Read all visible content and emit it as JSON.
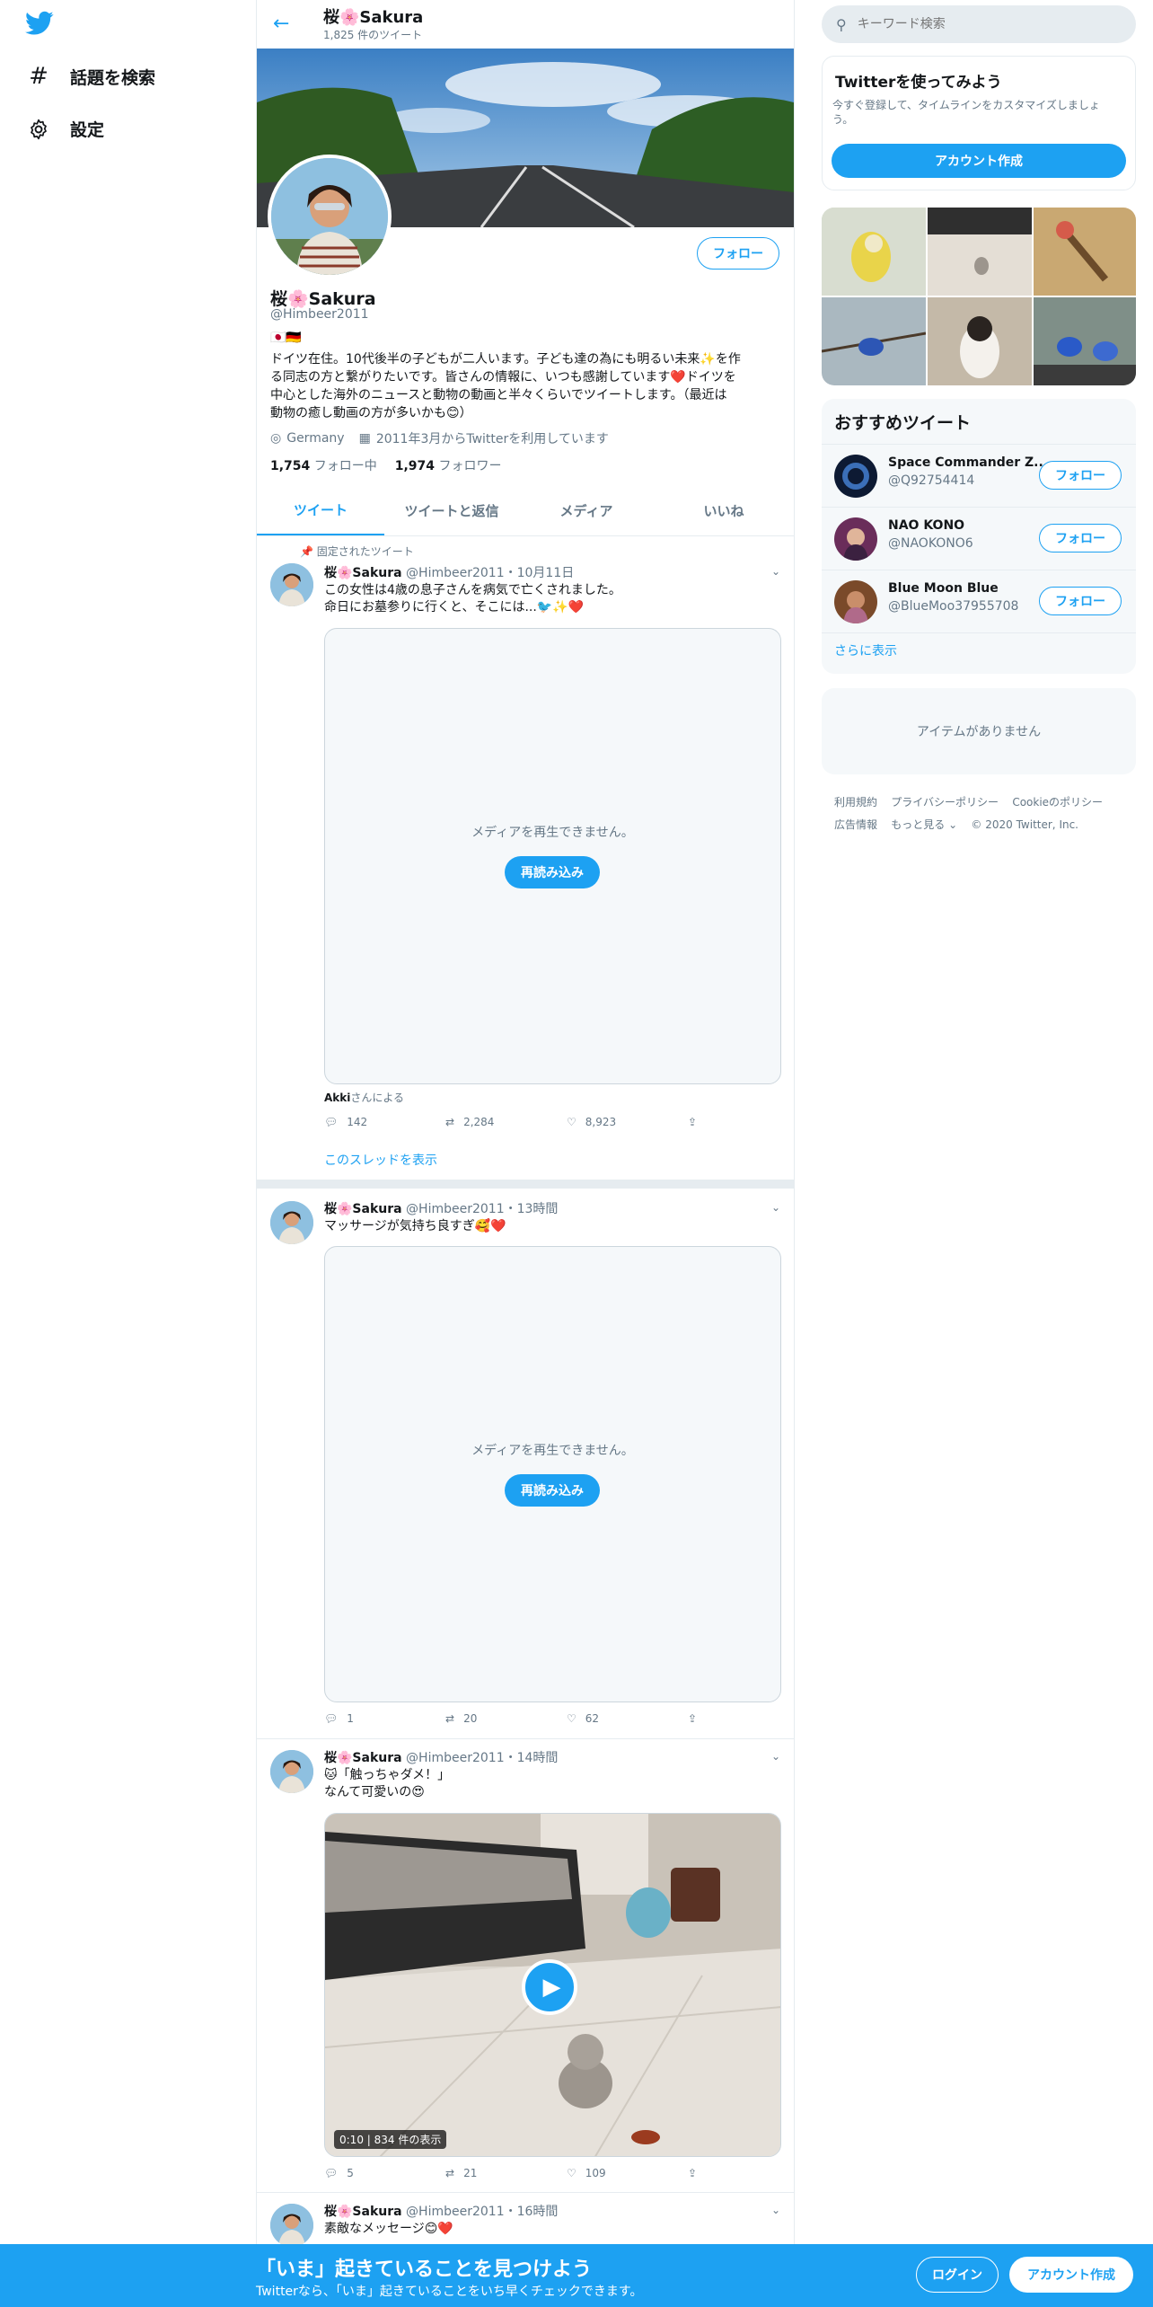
{
  "nav": {
    "explore_label": "話題を検索",
    "settings_label": "設定"
  },
  "header": {
    "name": "桜🌸Sakura",
    "tweet_count": "1,825 件のツイート"
  },
  "profile": {
    "follow_button": "フォロー",
    "name": "桜🌸Sakura",
    "handle": "@Himbeer2011",
    "flags": "🇯🇵🇩🇪",
    "bio_lines": [
      "ドイツ在住。10代後半の子どもが二人います。子ども達の為にも明るい未来✨を作",
      "る同志の方と繋がりたいです。皆さんの情報に、いつも感謝しています❤️ドイツを",
      "中心とした海外のニュースと動物の動画と半々くらいでツイートします。（最近は",
      "動物の癒し動画の方が多いかも😊）"
    ],
    "location": "Germany",
    "joined": "2011年3月からTwitterを利用しています",
    "following_count": "1,754",
    "following_label": "フォロー中",
    "followers_count": "1,974",
    "followers_label": "フォロワー"
  },
  "tabs": [
    "ツイート",
    "ツイートと返信",
    "メディア",
    "いいね"
  ],
  "tweets": [
    {
      "pinned_label": "固定されたツイート",
      "name": "桜🌸Sakura",
      "handle": "@Himbeer2011",
      "time": "・10月11日",
      "lines": [
        "この女性は4歳の息子さんを病気で亡くされました。",
        "命日にお墓参りに行くと、そこには...🐦✨❤️"
      ],
      "media_message": "メディアを再生できません。",
      "reload_label": "再読み込み",
      "attribution_name": "Akki",
      "attribution_suffix": "さんによる",
      "replies": "142",
      "retweets": "2,284",
      "likes": "8,923",
      "thread_link": "このスレッドを表示"
    },
    {
      "name": "桜🌸Sakura",
      "handle": "@Himbeer2011",
      "time": "・13時間",
      "lines": [
        "マッサージが気持ち良すぎ🥰❤️"
      ],
      "media_message": "メディアを再生できません。",
      "reload_label": "再読み込み",
      "replies": "1",
      "retweets": "20",
      "likes": "62"
    },
    {
      "name": "桜🌸Sakura",
      "handle": "@Himbeer2011",
      "time": "・14時間",
      "lines": [
        "🐱「触っちゃダメ！」",
        "なんて可愛いの😍"
      ],
      "video_duration": "0:10",
      "video_views": "834 件の表示",
      "replies": "5",
      "retweets": "21",
      "likes": "109"
    },
    {
      "name": "桜🌸Sakura",
      "handle": "@Himbeer2011",
      "time": "・16時間",
      "lines": [
        "素敵なメッセージ😊❤️"
      ]
    }
  ],
  "search": {
    "placeholder": "キーワード検索"
  },
  "signup_card": {
    "title": "Twitterを使ってみよう",
    "desc_lines": [
      "今すぐ登録して、タイムラインをカスタマイズしましょ",
      "う。"
    ],
    "button": "アカウント作成"
  },
  "recommended": {
    "title": "おすすめツイート",
    "users": [
      {
        "name": "Space Commander Z...",
        "handle": "@Q92754414",
        "button": "フォロー"
      },
      {
        "name": "NAO KONO",
        "handle": "@NAOKONO6",
        "button": "フォロー"
      },
      {
        "name": "Blue Moon Blue",
        "handle": "@BlueMoo37955708",
        "button": "フォロー"
      }
    ],
    "show_more": "さらに表示"
  },
  "trends_empty": "アイテムがありません",
  "footer": {
    "links": [
      "利用規約",
      "プライバシーポリシー",
      "Cookieのポリシー",
      "広告情報",
      "もっと見る ⌄"
    ],
    "copyright": "© 2020 Twitter, Inc."
  },
  "bottom_bar": {
    "headline": "「いま」起きていることを見つけよう",
    "subtext": "Twitterなら、「いま」起きていることをいち早くチェックできます。",
    "login": "ログイン",
    "signup": "アカウント作成"
  },
  "colors": {
    "accent": "#1da1f2",
    "muted": "#657786",
    "border": "#e6ecf0"
  }
}
